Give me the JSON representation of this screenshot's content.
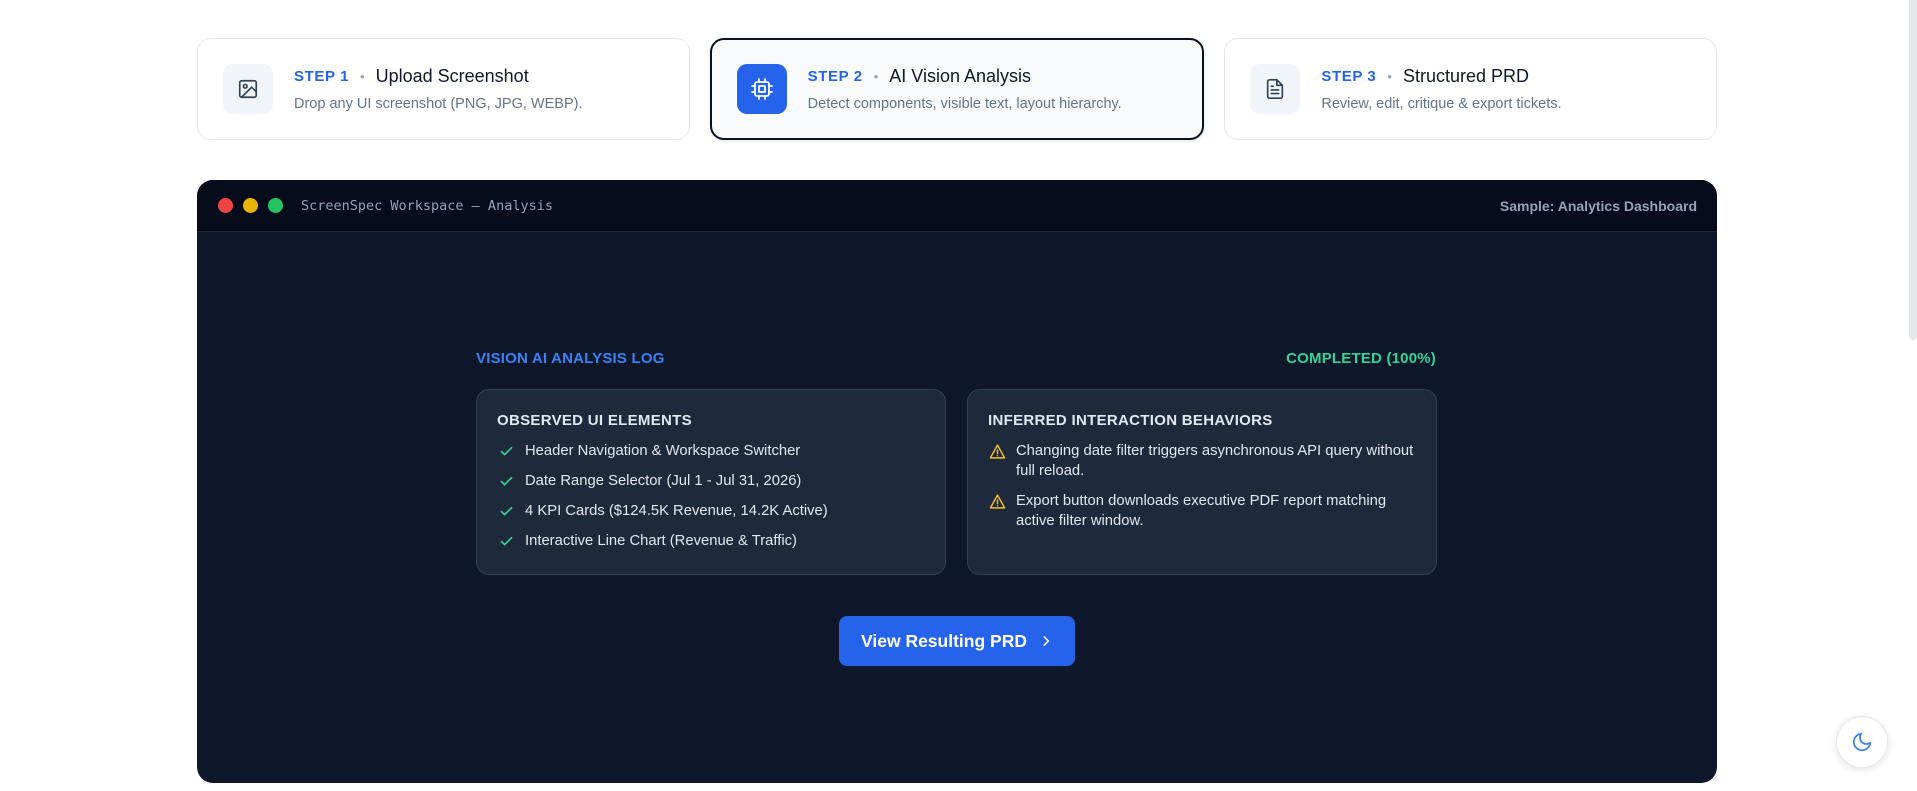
{
  "steps": [
    {
      "number": "STEP 1",
      "name": "Upload Screenshot",
      "description": "Drop any UI screenshot (PNG, JPG, WEBP).",
      "icon": "image-icon",
      "active": false
    },
    {
      "number": "STEP 2",
      "name": "AI Vision Analysis",
      "description": "Detect components, visible text, layout hierarchy.",
      "icon": "cpu-icon",
      "active": true
    },
    {
      "number": "STEP 3",
      "name": "Structured PRD",
      "description": "Review, edit, critique & export tickets.",
      "icon": "document-icon",
      "active": false
    }
  ],
  "step_separator": "•",
  "workspace": {
    "title": "ScreenSpec Workspace — Analysis",
    "sample_label": "Sample: Analytics Dashboard"
  },
  "analysis": {
    "log_title": "VISION AI ANALYSIS LOG",
    "status": "COMPLETED (100%)",
    "observed": {
      "title": "OBSERVED UI ELEMENTS",
      "items": [
        "Header Navigation & Workspace Switcher",
        "Date Range Selector (Jul 1 - Jul 31, 2026)",
        "4 KPI Cards ($124.5K Revenue, 14.2K Active)",
        "Interactive Line Chart (Revenue & Traffic)"
      ]
    },
    "inferred": {
      "title": "INFERRED INTERACTION BEHAVIORS",
      "items": [
        "Changing date filter triggers asynchronous API query without full reload.",
        "Export button downloads executive PDF report matching active filter window."
      ]
    }
  },
  "cta_label": "View Resulting PRD",
  "colors": {
    "accent": "#2563eb",
    "success": "#34d399",
    "warning": "#fbbf24",
    "workspace_bg": "#0f172a",
    "panel_bg": "#1e293b"
  },
  "icons": {
    "theme_toggle": "moon-icon",
    "cta": "chevron-right-icon"
  }
}
